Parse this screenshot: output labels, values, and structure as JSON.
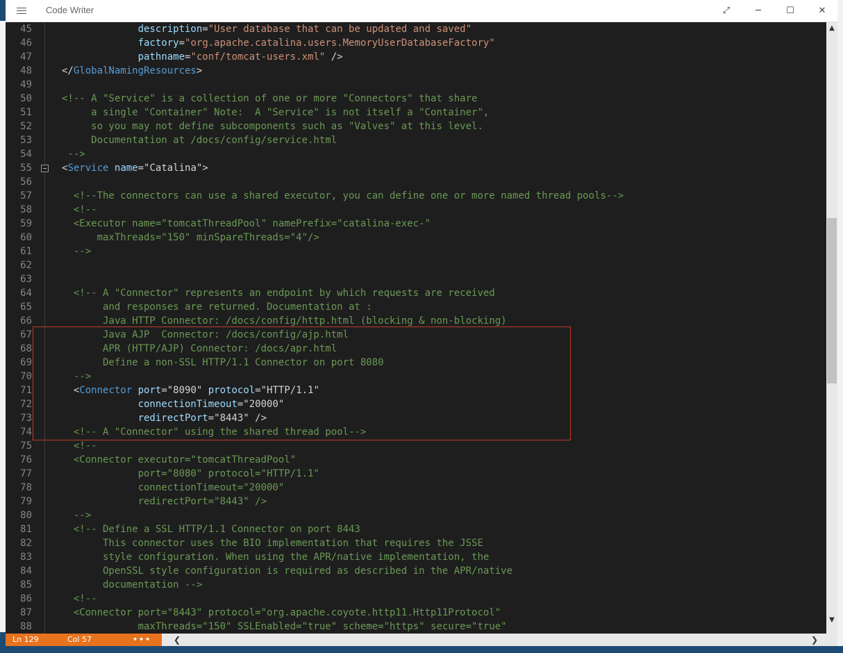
{
  "window": {
    "title": "Code Writer",
    "buttons": {
      "expand": "⤢",
      "minimize": "─",
      "maximize": "☐",
      "close": "✕"
    }
  },
  "editor": {
    "lines": [
      {
        "n": "45",
        "parts": [
          [
            "tx",
            "             "
          ],
          [
            "at",
            "description"
          ],
          [
            "tx",
            "="
          ],
          [
            "st",
            "\"User database that can be updated and saved\""
          ]
        ]
      },
      {
        "n": "46",
        "parts": [
          [
            "tx",
            "             "
          ],
          [
            "at",
            "factory"
          ],
          [
            "tx",
            "="
          ],
          [
            "st",
            "\"org.apache.catalina.users.MemoryUserDatabaseFactory\""
          ]
        ]
      },
      {
        "n": "47",
        "parts": [
          [
            "tx",
            "             "
          ],
          [
            "at",
            "pathname"
          ],
          [
            "tx",
            "="
          ],
          [
            "st",
            "\"conf/tomcat-users.xml\""
          ],
          [
            "tx",
            " />"
          ]
        ]
      },
      {
        "n": "48",
        "parts": [
          [
            "tx",
            "</"
          ],
          [
            "tg",
            "GlobalNamingResources"
          ],
          [
            "tx",
            ">"
          ]
        ]
      },
      {
        "n": "49",
        "parts": []
      },
      {
        "n": "50",
        "parts": [
          [
            "cm",
            "<!-- A \"Service\" is a collection of one or more \"Connectors\" that share"
          ]
        ]
      },
      {
        "n": "51",
        "parts": [
          [
            "cm",
            "     a single \"Container\" Note:  A \"Service\" is not itself a \"Container\","
          ]
        ]
      },
      {
        "n": "52",
        "parts": [
          [
            "cm",
            "     so you may not define subcomponents such as \"Valves\" at this level."
          ]
        ]
      },
      {
        "n": "53",
        "parts": [
          [
            "cm",
            "     Documentation at /docs/config/service.html"
          ]
        ]
      },
      {
        "n": "54",
        "parts": [
          [
            "cm",
            " -->"
          ]
        ]
      },
      {
        "n": "55",
        "fold": true,
        "parts": [
          [
            "tx",
            "<"
          ],
          [
            "tg",
            "Service"
          ],
          [
            "tx",
            " "
          ],
          [
            "at",
            "name"
          ],
          [
            "tx",
            "=\"Catalina\">"
          ]
        ]
      },
      {
        "n": "56",
        "parts": []
      },
      {
        "n": "57",
        "parts": [
          [
            "cm",
            "  <!--The connectors can use a shared executor, you can define one or more named thread pools-->"
          ]
        ]
      },
      {
        "n": "58",
        "parts": [
          [
            "cm",
            "  <!--"
          ]
        ]
      },
      {
        "n": "59",
        "parts": [
          [
            "cm",
            "  <Executor name=\"tomcatThreadPool\" namePrefix=\"catalina-exec-\""
          ]
        ]
      },
      {
        "n": "60",
        "parts": [
          [
            "cm",
            "      maxThreads=\"150\" minSpareThreads=\"4\"/>"
          ]
        ]
      },
      {
        "n": "61",
        "parts": [
          [
            "cm",
            "  -->"
          ]
        ]
      },
      {
        "n": "62",
        "parts": []
      },
      {
        "n": "63",
        "parts": []
      },
      {
        "n": "64",
        "parts": [
          [
            "cm",
            "  <!-- A \"Connector\" represents an endpoint by which requests are received"
          ]
        ]
      },
      {
        "n": "65",
        "parts": [
          [
            "cm",
            "       and responses are returned. Documentation at :"
          ]
        ]
      },
      {
        "n": "66",
        "parts": [
          [
            "cm",
            "       Java HTTP Connector: /docs/config/http.html (blocking & non-blocking)"
          ]
        ]
      },
      {
        "n": "67",
        "parts": [
          [
            "cm",
            "       Java AJP  Connector: /docs/config/ajp.html"
          ]
        ]
      },
      {
        "n": "68",
        "parts": [
          [
            "cm",
            "       APR (HTTP/AJP) Connector: /docs/apr.html"
          ]
        ]
      },
      {
        "n": "69",
        "parts": [
          [
            "cm",
            "       Define a non-SSL HTTP/1.1 Connector on port 8080"
          ]
        ]
      },
      {
        "n": "70",
        "parts": [
          [
            "cm",
            "  -->"
          ]
        ]
      },
      {
        "n": "71",
        "parts": [
          [
            "tx",
            "  <"
          ],
          [
            "tg",
            "Connector"
          ],
          [
            "tx",
            " "
          ],
          [
            "at",
            "port"
          ],
          [
            "tx",
            "=\"8090\" "
          ],
          [
            "at",
            "protocol"
          ],
          [
            "tx",
            "=\"HTTP/1.1\""
          ]
        ]
      },
      {
        "n": "72",
        "parts": [
          [
            "tx",
            "             "
          ],
          [
            "at",
            "connectionTimeout"
          ],
          [
            "tx",
            "=\"20000\""
          ]
        ]
      },
      {
        "n": "73",
        "parts": [
          [
            "tx",
            "             "
          ],
          [
            "at",
            "redirectPort"
          ],
          [
            "tx",
            "=\"8443\" />"
          ]
        ]
      },
      {
        "n": "74",
        "parts": [
          [
            "cm",
            "  <!-- A \"Connector\" using the shared thread pool-->"
          ]
        ]
      },
      {
        "n": "75",
        "parts": [
          [
            "cm",
            "  <!--"
          ]
        ]
      },
      {
        "n": "76",
        "parts": [
          [
            "cm",
            "  <Connector executor=\"tomcatThreadPool\""
          ]
        ]
      },
      {
        "n": "77",
        "parts": [
          [
            "cm",
            "             port=\"8080\" protocol=\"HTTP/1.1\""
          ]
        ]
      },
      {
        "n": "78",
        "parts": [
          [
            "cm",
            "             connectionTimeout=\"20000\""
          ]
        ]
      },
      {
        "n": "79",
        "parts": [
          [
            "cm",
            "             redirectPort=\"8443\" />"
          ]
        ]
      },
      {
        "n": "80",
        "parts": [
          [
            "cm",
            "  -->"
          ]
        ]
      },
      {
        "n": "81",
        "parts": [
          [
            "cm",
            "  <!-- Define a SSL HTTP/1.1 Connector on port 8443"
          ]
        ]
      },
      {
        "n": "82",
        "parts": [
          [
            "cm",
            "       This connector uses the BIO implementation that requires the JSSE"
          ]
        ]
      },
      {
        "n": "83",
        "parts": [
          [
            "cm",
            "       style configuration. When using the APR/native implementation, the"
          ]
        ]
      },
      {
        "n": "84",
        "parts": [
          [
            "cm",
            "       OpenSSL style configuration is required as described in the APR/native"
          ]
        ]
      },
      {
        "n": "85",
        "parts": [
          [
            "cm",
            "       documentation -->"
          ]
        ]
      },
      {
        "n": "86",
        "parts": [
          [
            "cm",
            "  <!--"
          ]
        ]
      },
      {
        "n": "87",
        "parts": [
          [
            "cm",
            "  <Connector port=\"8443\" protocol=\"org.apache.coyote.http11.Http11Protocol\""
          ]
        ]
      },
      {
        "n": "88",
        "parts": [
          [
            "cm",
            "             maxThreads=\"150\" SSLEnabled=\"true\" scheme=\"https\" secure=\"true\""
          ]
        ]
      }
    ]
  },
  "statusbar": {
    "line": "Ln 129",
    "col": "Col 57",
    "more": "•••"
  },
  "scroll": {
    "up": "▲",
    "down": "▼",
    "left": "❮",
    "right": "❯"
  }
}
